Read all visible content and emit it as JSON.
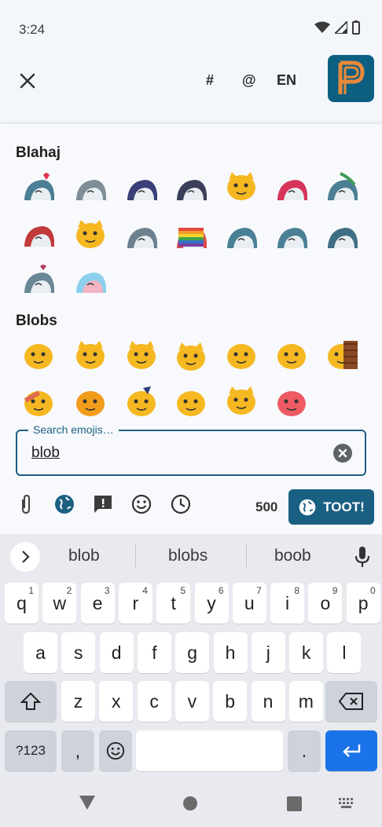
{
  "status": {
    "time": "3:24",
    "icons": [
      "wifi-icon",
      "signal-icon",
      "battery-icon"
    ]
  },
  "top_bar": {
    "close_icon": "close-icon",
    "hashtag": "#",
    "mention": "@",
    "language": "EN",
    "logo": "app-logo"
  },
  "emoji_panel": {
    "sections": [
      {
        "title": "Blahaj"
      },
      {
        "title": "Blobs"
      }
    ]
  },
  "search": {
    "label": "Search emojis…",
    "value": "blob",
    "clear_icon": "clear-icon"
  },
  "compose_toolbar": {
    "icons": [
      "attachment-icon",
      "globe-icon",
      "content-warning-icon",
      "emoji-icon",
      "schedule-icon"
    ],
    "char_count": "500",
    "toot_label": "TOOT!"
  },
  "keyboard": {
    "suggestions": [
      "blob",
      "blobs",
      "boob"
    ],
    "row1": [
      {
        "k": "q",
        "n": "1"
      },
      {
        "k": "w",
        "n": "2"
      },
      {
        "k": "e",
        "n": "3"
      },
      {
        "k": "r",
        "n": "4"
      },
      {
        "k": "t",
        "n": "5"
      },
      {
        "k": "y",
        "n": "6"
      },
      {
        "k": "u",
        "n": "7"
      },
      {
        "k": "i",
        "n": "8"
      },
      {
        "k": "o",
        "n": "9"
      },
      {
        "k": "p",
        "n": "0"
      }
    ],
    "row2": [
      "a",
      "s",
      "d",
      "f",
      "g",
      "h",
      "j",
      "k",
      "l"
    ],
    "row3": [
      "z",
      "x",
      "c",
      "v",
      "b",
      "n",
      "m"
    ],
    "symbols_label": "?123",
    "comma": ",",
    "period": "."
  },
  "colors": {
    "accent": "#195f82",
    "enter": "#1a73e8",
    "panel": "#f8f9fc"
  }
}
